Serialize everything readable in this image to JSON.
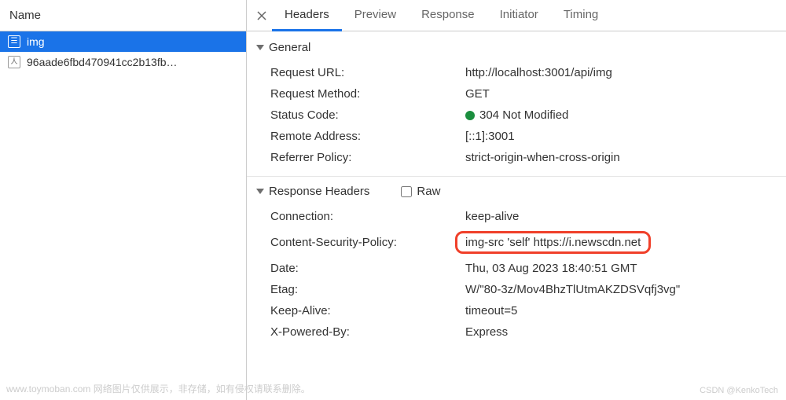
{
  "sidebar": {
    "header": "Name",
    "items": [
      {
        "icon": "document-icon",
        "glyph": "☰",
        "name": "img",
        "selected": true
      },
      {
        "icon": "script-icon",
        "glyph": "人",
        "name": "96aade6fbd470941cc2b13fb…",
        "selected": false
      }
    ]
  },
  "tabs": {
    "items": [
      {
        "label": "Headers",
        "active": true
      },
      {
        "label": "Preview",
        "active": false
      },
      {
        "label": "Response",
        "active": false
      },
      {
        "label": "Initiator",
        "active": false
      },
      {
        "label": "Timing",
        "active": false
      }
    ]
  },
  "general": {
    "title": "General",
    "rows": [
      {
        "key": "Request URL:",
        "val": "http://localhost:3001/api/img"
      },
      {
        "key": "Request Method:",
        "val": "GET"
      },
      {
        "key": "Status Code:",
        "val": "304 Not Modified",
        "status_dot": true
      },
      {
        "key": "Remote Address:",
        "val": "[::1]:3001"
      },
      {
        "key": "Referrer Policy:",
        "val": "strict-origin-when-cross-origin"
      }
    ]
  },
  "response_headers": {
    "title": "Response Headers",
    "raw_label": "Raw",
    "rows": [
      {
        "key": "Connection:",
        "val": "keep-alive"
      },
      {
        "key": "Content-Security-Policy:",
        "val": "img-src 'self' https://i.newscdn.net",
        "highlight": true
      },
      {
        "key": "Date:",
        "val": "Thu, 03 Aug 2023 18:40:51 GMT"
      },
      {
        "key": "Etag:",
        "val": "W/\"80-3z/Mov4BhzTlUtmAKZDSVqfj3vg\""
      },
      {
        "key": "Keep-Alive:",
        "val": "timeout=5"
      },
      {
        "key": "X-Powered-By:",
        "val": "Express"
      }
    ]
  },
  "watermarks": {
    "left": "www.toymoban.com 网络图片仅供展示，非存储，如有侵权请联系删除。",
    "right": "CSDN @KenkoTech"
  }
}
